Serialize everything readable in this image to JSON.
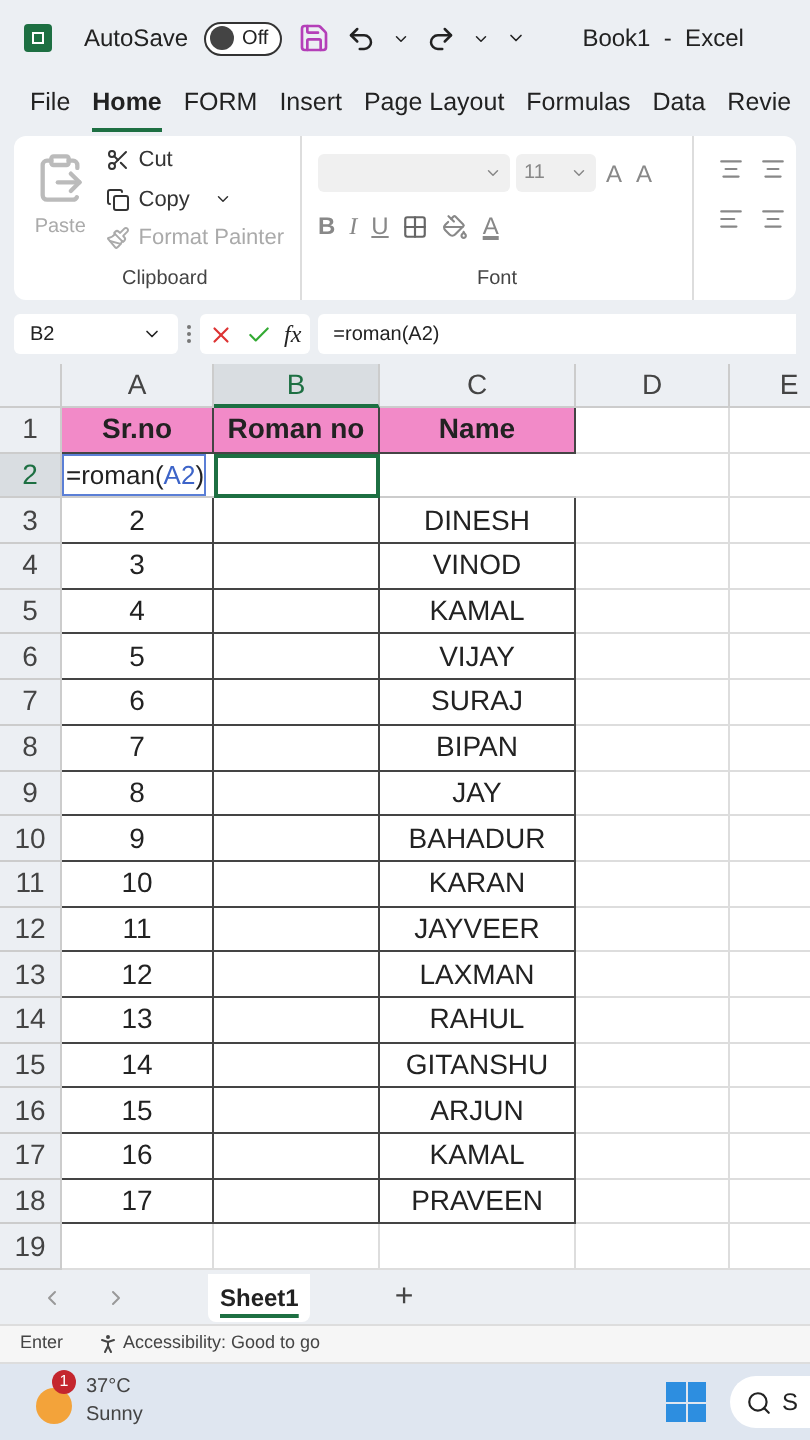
{
  "title_bar": {
    "autosave_label": "AutoSave",
    "autosave_on": false,
    "autosave_state": "Off",
    "title": "Book1  -  Excel"
  },
  "menu_tabs": [
    {
      "label": "File",
      "selected": false
    },
    {
      "label": "Home",
      "selected": true
    },
    {
      "label": "FORM",
      "selected": false
    },
    {
      "label": "Insert",
      "selected": false
    },
    {
      "label": "Page Layout",
      "selected": false
    },
    {
      "label": "Formulas",
      "selected": false
    },
    {
      "label": "Data",
      "selected": false
    },
    {
      "label": "Revie",
      "selected": false
    }
  ],
  "ribbon": {
    "clipboard": {
      "paste": "Paste",
      "cut": "Cut",
      "copy": "Copy",
      "format_painter": "Format Painter",
      "label": "Clipboard"
    },
    "font": {
      "size": "11",
      "grow": "A",
      "shrink": "A",
      "bold": "B",
      "italic": "I",
      "underline": "U",
      "font_color": "A",
      "label": "Font"
    }
  },
  "formula_bar": {
    "name_box": "B2",
    "fx": "fx",
    "formula": "=roman(A2)"
  },
  "sheet": {
    "columns": [
      {
        "label": "A",
        "selected": false
      },
      {
        "label": "B",
        "selected": true
      },
      {
        "label": "C",
        "selected": false
      },
      {
        "label": "D",
        "selected": false
      },
      {
        "label": "E",
        "selected": false
      }
    ],
    "editing": {
      "before": "=roman(",
      "ref": "A2",
      "after": ")"
    },
    "rows": [
      {
        "number": "1",
        "selected": false,
        "kind": "header",
        "cells": [
          "Sr.no",
          "Roman no",
          "Name"
        ]
      },
      {
        "number": "2",
        "selected": true,
        "kind": "edit"
      },
      {
        "number": "3",
        "selected": false,
        "kind": "data",
        "cells": [
          "2",
          "DINESH"
        ]
      },
      {
        "number": "4",
        "selected": false,
        "kind": "data",
        "cells": [
          "3",
          "VINOD"
        ]
      },
      {
        "number": "5",
        "selected": false,
        "kind": "data",
        "cells": [
          "4",
          "KAMAL"
        ]
      },
      {
        "number": "6",
        "selected": false,
        "kind": "data",
        "cells": [
          "5",
          "VIJAY"
        ]
      },
      {
        "number": "7",
        "selected": false,
        "kind": "data",
        "cells": [
          "6",
          "SURAJ"
        ]
      },
      {
        "number": "8",
        "selected": false,
        "kind": "data",
        "cells": [
          "7",
          "BIPAN"
        ]
      },
      {
        "number": "9",
        "selected": false,
        "kind": "data",
        "cells": [
          "8",
          "JAY"
        ]
      },
      {
        "number": "10",
        "selected": false,
        "kind": "data",
        "cells": [
          "9",
          "BAHADUR"
        ]
      },
      {
        "number": "11",
        "selected": false,
        "kind": "data",
        "cells": [
          "10",
          "KARAN"
        ]
      },
      {
        "number": "12",
        "selected": false,
        "kind": "data",
        "cells": [
          "11",
          "JAYVEER"
        ]
      },
      {
        "number": "13",
        "selected": false,
        "kind": "data",
        "cells": [
          "12",
          "LAXMAN"
        ]
      },
      {
        "number": "14",
        "selected": false,
        "kind": "data",
        "cells": [
          "13",
          "RAHUL"
        ]
      },
      {
        "number": "15",
        "selected": false,
        "kind": "data",
        "cells": [
          "14",
          "GITANSHU"
        ]
      },
      {
        "number": "16",
        "selected": false,
        "kind": "data",
        "cells": [
          "15",
          "ARJUN"
        ]
      },
      {
        "number": "17",
        "selected": false,
        "kind": "data",
        "cells": [
          "16",
          "KAMAL"
        ]
      },
      {
        "number": "18",
        "selected": false,
        "kind": "data",
        "cells": [
          "17",
          "PRAVEEN"
        ]
      },
      {
        "number": "19",
        "selected": false,
        "kind": "empty"
      }
    ]
  },
  "sheet_tabs": [
    {
      "label": "Sheet1",
      "selected": true
    }
  ],
  "add_sheet": "+",
  "status_bar": {
    "mode": "Enter",
    "accessibility": "Accessibility: Good to go"
  },
  "taskbar": {
    "badge": "1",
    "temperature": "37°C",
    "condition": "Sunny",
    "search_hint": "S"
  }
}
